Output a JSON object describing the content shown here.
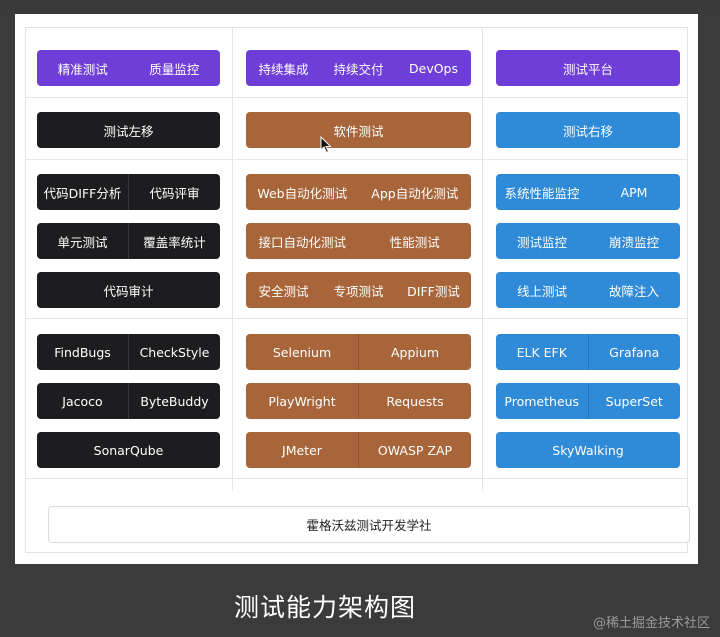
{
  "caption": "测试能力架构图",
  "watermark": "@稀土掘金技术社区",
  "footer": "霍格沃兹测试开发学社",
  "col1": {
    "header": [
      "精准测试",
      "质量监控"
    ],
    "title": "测试左移",
    "r1": [
      "代码DIFF分析",
      "代码评审"
    ],
    "r2": [
      "单元测试",
      "覆盖率统计"
    ],
    "r3": [
      "代码审计"
    ],
    "t1": [
      "FindBugs",
      "CheckStyle"
    ],
    "t2": [
      "Jacoco",
      "ByteBuddy"
    ],
    "t3": [
      "SonarQube"
    ]
  },
  "col2": {
    "header": [
      "持续集成",
      "持续交付",
      "DevOps"
    ],
    "title": "软件测试",
    "r1": [
      "Web自动化测试",
      "App自动化测试"
    ],
    "r2": [
      "接口自动化测试",
      "性能测试"
    ],
    "r3": [
      "安全测试",
      "专项测试",
      "DIFF测试"
    ],
    "t1": [
      "Selenium",
      "Appium"
    ],
    "t2": [
      "PlayWright",
      "Requests"
    ],
    "t3": [
      "JMeter",
      "OWASP ZAP"
    ]
  },
  "col3": {
    "header": [
      "测试平台"
    ],
    "title": "测试右移",
    "r1": [
      "系统性能监控",
      "APM"
    ],
    "r2": [
      "测试监控",
      "崩溃监控"
    ],
    "r3": [
      "线上测试",
      "故障注入"
    ],
    "t1": [
      "ELK EFK",
      "Grafana"
    ],
    "t2": [
      "Prometheus",
      "SuperSet"
    ],
    "t3": [
      "SkyWalking"
    ]
  },
  "colors": {
    "purple": "#6f3ed9",
    "black": "#1d1d1f",
    "brown": "#a8653a",
    "blue": "#2f8ad8"
  }
}
